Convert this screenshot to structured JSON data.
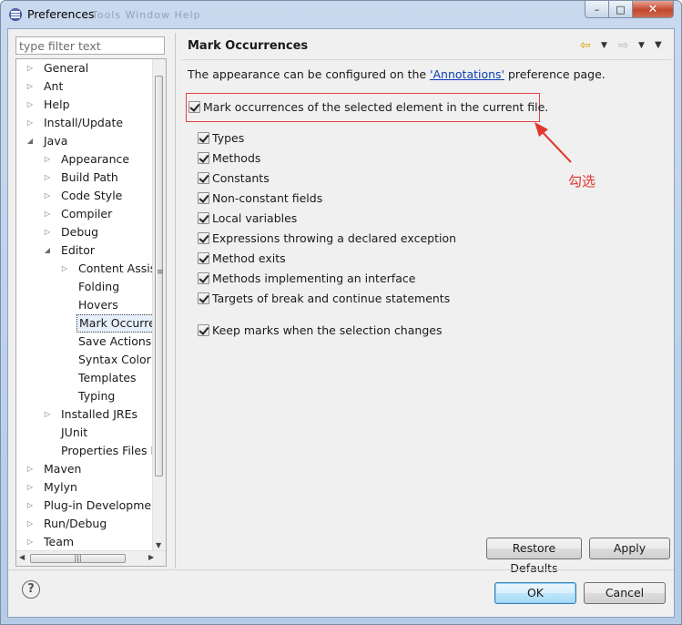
{
  "window": {
    "title": "Preferences",
    "ghost_menu": "Tools  Window  Help",
    "minimize": "–",
    "maximize": "□",
    "close": "✕"
  },
  "filter": {
    "placeholder": "type filter text"
  },
  "tree": [
    {
      "label": "General",
      "level": 0,
      "arrow": "▷"
    },
    {
      "label": "Ant",
      "level": 0,
      "arrow": "▷"
    },
    {
      "label": "Help",
      "level": 0,
      "arrow": "▷"
    },
    {
      "label": "Install/Update",
      "level": 0,
      "arrow": "▷"
    },
    {
      "label": "Java",
      "level": 0,
      "arrow": "◢"
    },
    {
      "label": "Appearance",
      "level": 1,
      "arrow": "▷"
    },
    {
      "label": "Build Path",
      "level": 1,
      "arrow": "▷"
    },
    {
      "label": "Code Style",
      "level": 1,
      "arrow": "▷"
    },
    {
      "label": "Compiler",
      "level": 1,
      "arrow": "▷"
    },
    {
      "label": "Debug",
      "level": 1,
      "arrow": "▷"
    },
    {
      "label": "Editor",
      "level": 1,
      "arrow": "◢"
    },
    {
      "label": "Content Assist",
      "level": 2,
      "arrow": "▷"
    },
    {
      "label": "Folding",
      "level": 2,
      "arrow": ""
    },
    {
      "label": "Hovers",
      "level": 2,
      "arrow": ""
    },
    {
      "label": "Mark Occurrences",
      "level": 2,
      "arrow": "",
      "selected": true
    },
    {
      "label": "Save Actions",
      "level": 2,
      "arrow": ""
    },
    {
      "label": "Syntax Coloring",
      "level": 2,
      "arrow": ""
    },
    {
      "label": "Templates",
      "level": 2,
      "arrow": ""
    },
    {
      "label": "Typing",
      "level": 2,
      "arrow": ""
    },
    {
      "label": "Installed JREs",
      "level": 1,
      "arrow": "▷"
    },
    {
      "label": "JUnit",
      "level": 1,
      "arrow": ""
    },
    {
      "label": "Properties Files Editor",
      "level": 1,
      "arrow": ""
    },
    {
      "label": "Maven",
      "level": 0,
      "arrow": "▷"
    },
    {
      "label": "Mylyn",
      "level": 0,
      "arrow": "▷"
    },
    {
      "label": "Plug-in Development",
      "level": 0,
      "arrow": "▷"
    },
    {
      "label": "Run/Debug",
      "level": 0,
      "arrow": "▷"
    },
    {
      "label": "Team",
      "level": 0,
      "arrow": "▷"
    }
  ],
  "page": {
    "title": "Mark Occurrences",
    "desc_before": "The appearance can be configured on the ",
    "desc_link": "'Annotations'",
    "desc_after": " preference page.",
    "main_option": {
      "label": "Mark occurrences of the selected element in the current file.",
      "checked": true
    },
    "options": [
      {
        "label": "Types",
        "checked": true
      },
      {
        "label": "Methods",
        "checked": true
      },
      {
        "label": "Constants",
        "checked": true
      },
      {
        "label": "Non-constant fields",
        "checked": true
      },
      {
        "label": "Local variables",
        "checked": true
      },
      {
        "label": "Expressions throwing a declared exception",
        "checked": true
      },
      {
        "label": "Method exits",
        "checked": true
      },
      {
        "label": "Methods implementing an interface",
        "checked": true
      },
      {
        "label": "Targets of break and continue statements",
        "checked": true
      }
    ],
    "keep_marks": {
      "label": "Keep marks when the selection changes",
      "checked": true
    },
    "annotation": "勾选",
    "annotation_color": "#e0382f"
  },
  "nav": {
    "back": "⇦",
    "forward": "⇨",
    "dropdown": "▼",
    "menu": "▼"
  },
  "buttons": {
    "restore": "Restore Defaults",
    "apply": "Apply",
    "ok": "OK",
    "cancel": "Cancel",
    "help": "?"
  },
  "scroll": {
    "grip": "≡",
    "up": "▲",
    "down": "▼",
    "left": "◀",
    "right": "▶",
    "hgrip": "|||"
  }
}
